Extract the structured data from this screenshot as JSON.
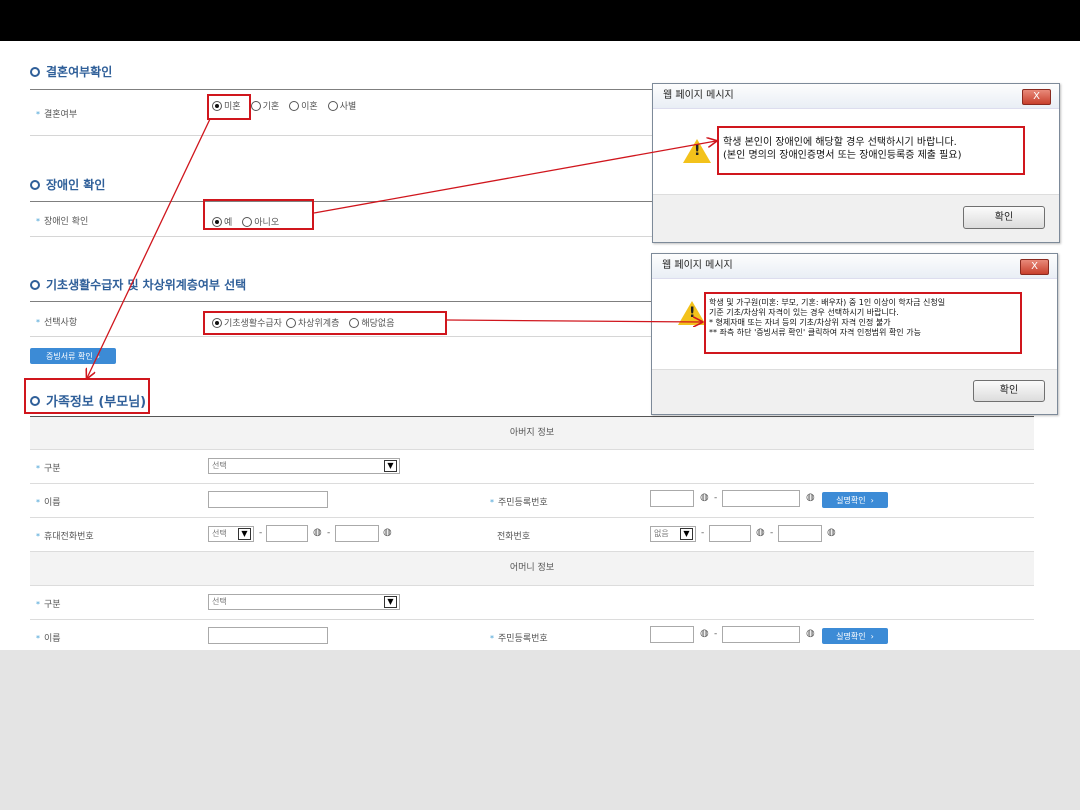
{
  "marriage": {
    "section_title": "결혼여부확인",
    "label": "결혼여부",
    "options": [
      "미혼",
      "기혼",
      "이혼",
      "사별"
    ]
  },
  "disability": {
    "section_title": "장애인 확인",
    "label": "장애인 확인",
    "options": [
      "예",
      "아니오"
    ]
  },
  "basic_living": {
    "section_title": "기초생활수급자 및 차상위계층여부 선택",
    "label": "선택사항",
    "options": [
      "기초생활수급자",
      "차상위계층",
      "해당없음"
    ],
    "doc_button": "증빙서류 확인"
  },
  "family": {
    "section_title": "가족정보 (부모님)",
    "father_header": "아버지 정보",
    "mother_header": "어머니 정보",
    "type_label": "구분",
    "type_value": "선택",
    "name_label": "이름",
    "rrn_label": "주민등록번호",
    "verify_button": "실명확인",
    "mobile_label": "휴대전화번호",
    "mobile_select": "선택",
    "phone_label": "전화번호",
    "phone_select": "없음",
    "dash": "-"
  },
  "dialog1": {
    "title": "웹 페이지 메시지",
    "close": "X",
    "line1": "학생 본인이 장애인에 해당할 경우 선택하시기 바랍니다.",
    "line2": "(본인 명의의 장애인증명서 또는 장애인등록증 제출 필요)",
    "ok": "확인"
  },
  "dialog2": {
    "title": "웹 페이지 메시지",
    "close": "X",
    "line1": "학생 및 가구원(미혼: 부모, 기혼: 배우자) 중 1인 이상이 학자금 신청일",
    "line2": "기준 기초/차상위 자격이 있는 경우 선택하시기 바랍니다.",
    "line3": "* 형제자매 또는 자녀 등의 기초/차상위 자격 인정 불가",
    "line4": "** 좌측 하단 '증빙서류 확인' 클릭하여 자격 인정범위 확인 가능",
    "ok": "확인"
  },
  "colors": {
    "accent": "#2f5f99",
    "highlight": "#d0161d",
    "button": "#3c8bd6"
  }
}
